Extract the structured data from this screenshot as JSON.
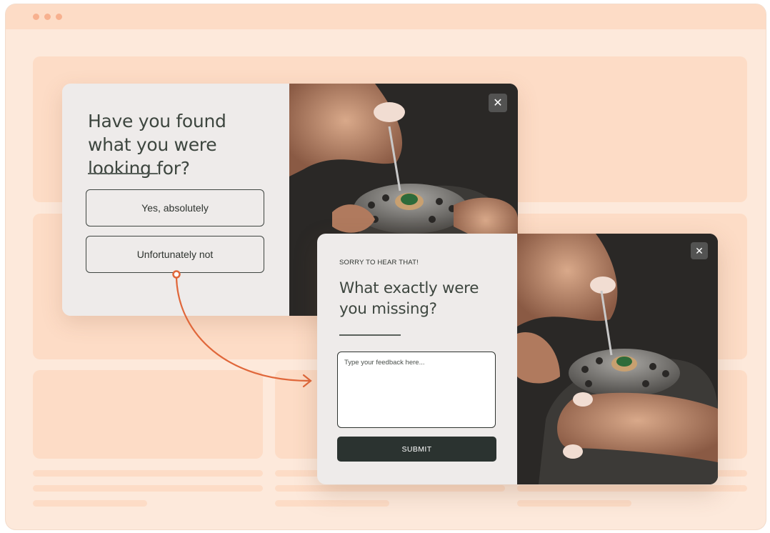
{
  "colors": {
    "browser_bg": "#fde9db",
    "placeholder_blocks": "#fddcc6",
    "popup_bg": "#eeebea",
    "primary_dark": "#2b3330",
    "accent_arrow": "#e0673a"
  },
  "popup1": {
    "title": "Have you found what you were looking for?",
    "option_yes": "Yes, absolutely",
    "option_no": "Unfortunately not",
    "close_icon": "close-icon",
    "image": "jeweler-setting-gemstone-photo"
  },
  "popup2": {
    "eyebrow": "SORRY TO HEAR THAT!",
    "title": "What exactly were you missing?",
    "feedback_placeholder": "Type your feedback here...",
    "submit_label": "SUBMIT",
    "close_icon": "close-icon",
    "image": "jeweler-setting-gemstone-photo"
  },
  "flow_arrow": "arrow-from-option-no-to-popup2"
}
